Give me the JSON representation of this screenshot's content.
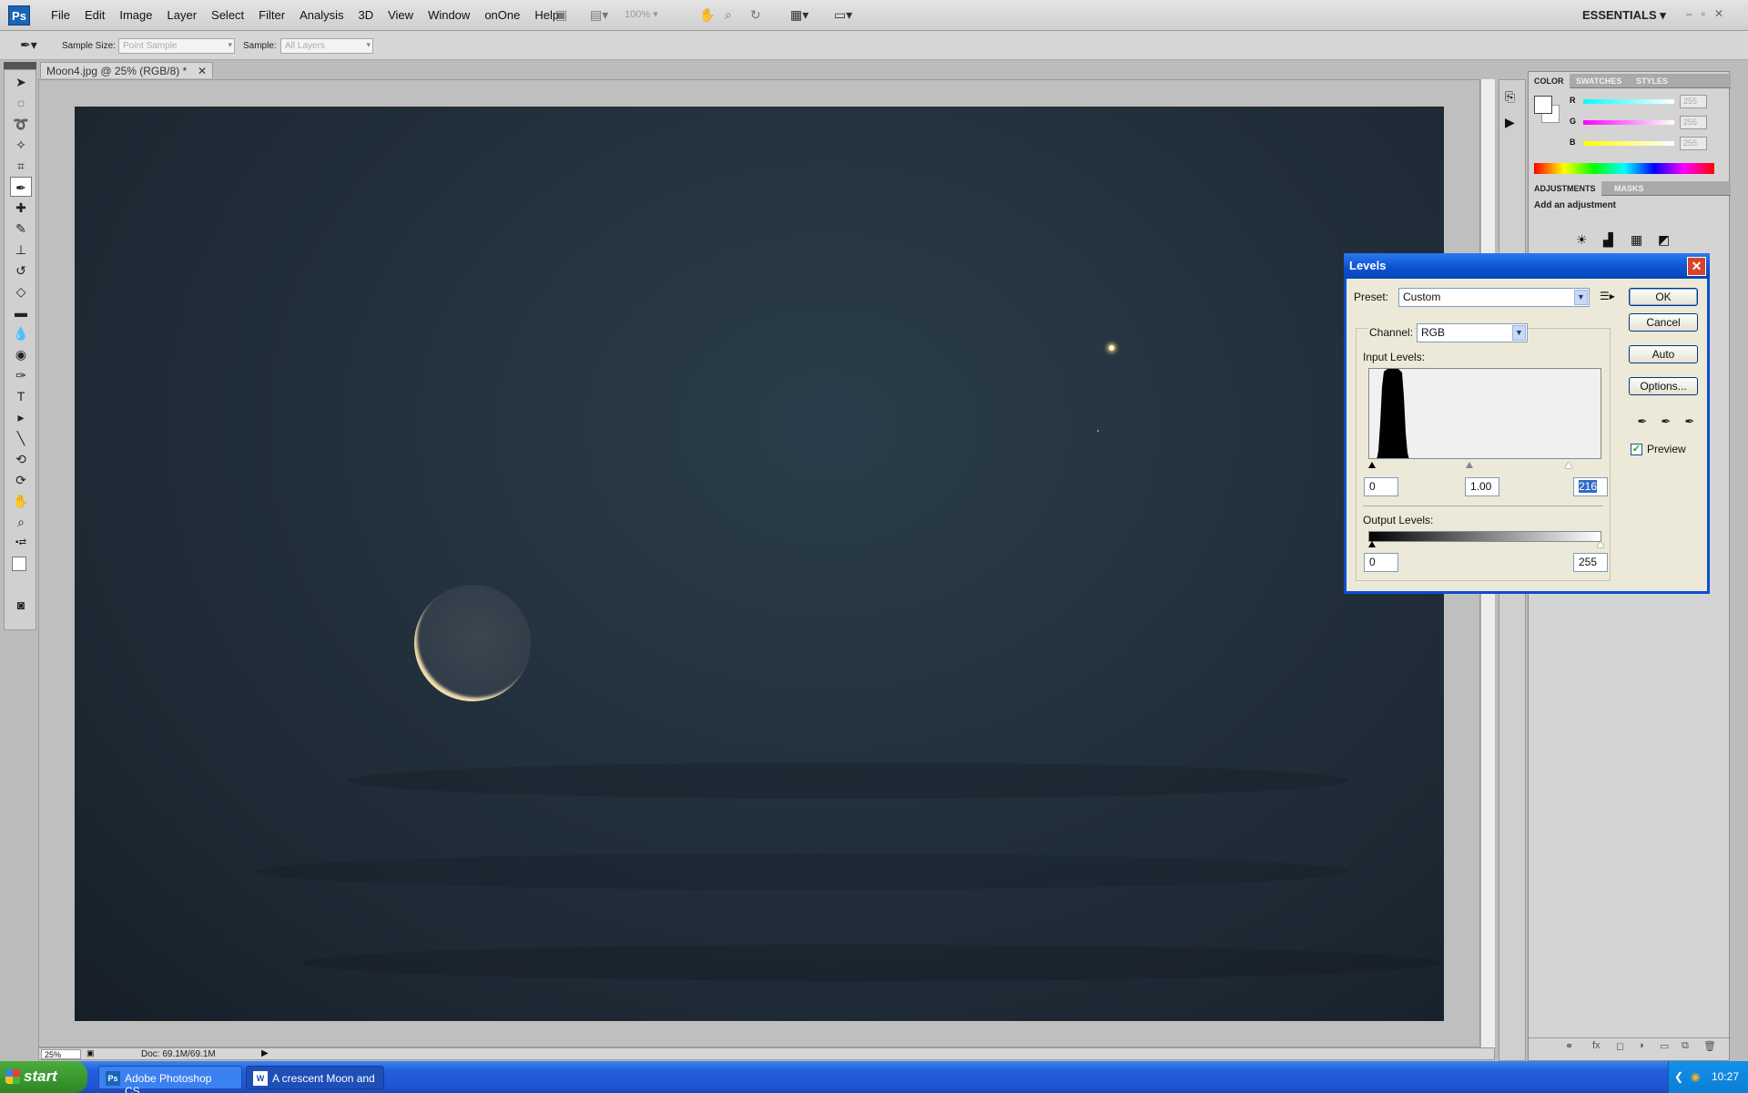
{
  "app": {
    "logo": "Ps",
    "menus": [
      "File",
      "Edit",
      "Image",
      "Layer",
      "Select",
      "Filter",
      "Analysis",
      "3D",
      "View",
      "Window",
      "onOne",
      "Help"
    ],
    "zoom": "100%",
    "workspace": "ESSENTIALS",
    "window_controls": [
      "–",
      "▫",
      "✕"
    ]
  },
  "options_bar": {
    "sample_size_label": "Sample Size:",
    "sample_size_value": "Point Sample",
    "sample_label": "Sample:",
    "sample_value": "All Layers"
  },
  "document": {
    "tab_title": "Moon4.jpg @ 25% (RGB/8) *",
    "status_zoom": "25%",
    "status_doc": "Doc: 69.1M/69.1M"
  },
  "panels": {
    "color_tabs": [
      "COLOR",
      "SWATCHES",
      "STYLES"
    ],
    "color_rows": [
      {
        "label": "R",
        "value": "255"
      },
      {
        "label": "G",
        "value": "255"
      },
      {
        "label": "B",
        "value": "255"
      }
    ],
    "adjust_tabs": [
      "ADJUSTMENTS",
      "MASKS"
    ],
    "add_adjustment": "Add an adjustment"
  },
  "levels_dialog": {
    "title": "Levels",
    "preset_label": "Preset:",
    "preset_value": "Custom",
    "channel_label": "Channel:",
    "channel_value": "RGB",
    "input_levels_label": "Input Levels:",
    "input_black": "0",
    "input_gamma": "1.00",
    "input_white": "216",
    "output_levels_label": "Output Levels:",
    "output_black": "0",
    "output_white": "255",
    "buttons": {
      "ok": "OK",
      "cancel": "Cancel",
      "auto": "Auto",
      "options": "Options..."
    },
    "preview_label": "Preview",
    "preview_checked": true
  },
  "taskbar": {
    "start": "start",
    "tasks": [
      {
        "label": "Adobe Photoshop CS...",
        "icon": "Ps"
      },
      {
        "label": "A crescent Moon and ...",
        "icon": "W"
      }
    ],
    "clock": "10:27"
  }
}
